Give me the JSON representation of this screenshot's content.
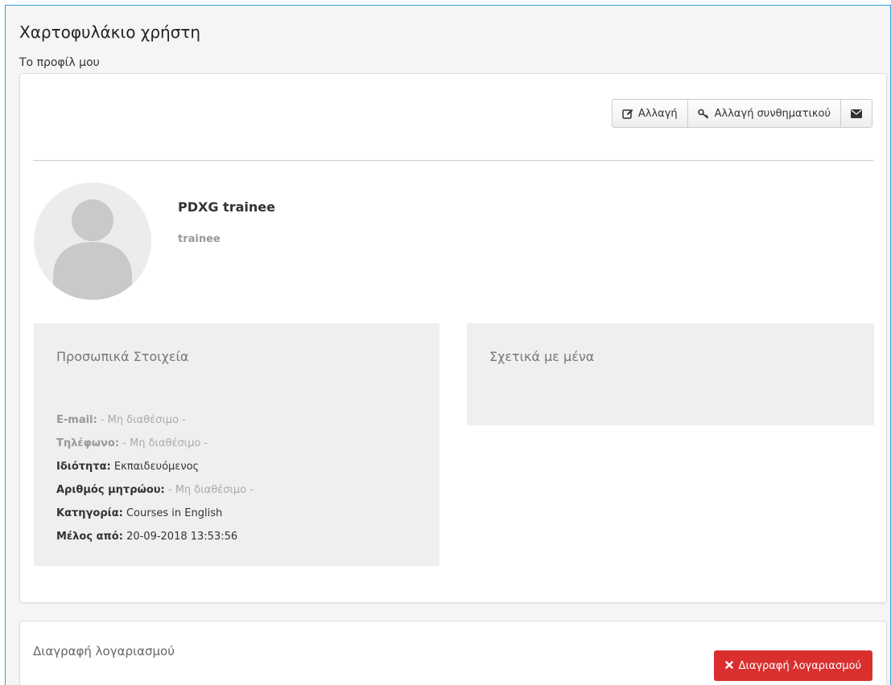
{
  "page": {
    "title": "Χαρτοφυλάκιο χρήστη",
    "subtitle": "Το προφίλ μου"
  },
  "toolbar": {
    "edit_label": "Αλλαγή",
    "change_password_label": "Αλλαγή συνθηματικού",
    "message_icon": "envelope-icon"
  },
  "profile": {
    "name": "PDXG trainee",
    "username": "trainee"
  },
  "personal": {
    "title": "Προσωπικά Στοιχεία",
    "rows": [
      {
        "label": "E-mail:",
        "value": "- Μη διαθέσιμο -"
      },
      {
        "label": "Τηλέφωνο:",
        "value": "- Μη διαθέσιμο -"
      },
      {
        "label": "Ιδιότητα:",
        "value": "Εκπαιδευόμενος"
      },
      {
        "label": "Αριθμός μητρώου:",
        "value": "- Μη διαθέσιμο -"
      },
      {
        "label": "Κατηγορία:",
        "value": "Courses in English"
      },
      {
        "label": "Μέλος από:",
        "value": "20-09-2018 13:53:56"
      }
    ]
  },
  "about": {
    "title": "Σχετικά με μένα"
  },
  "delete_account": {
    "title": "Διαγραφή λογαριασμού",
    "button_label": "Διαγραφή λογαριασμού"
  },
  "colors": {
    "frame_border": "#2a9fd6",
    "danger": "#d9302f"
  }
}
